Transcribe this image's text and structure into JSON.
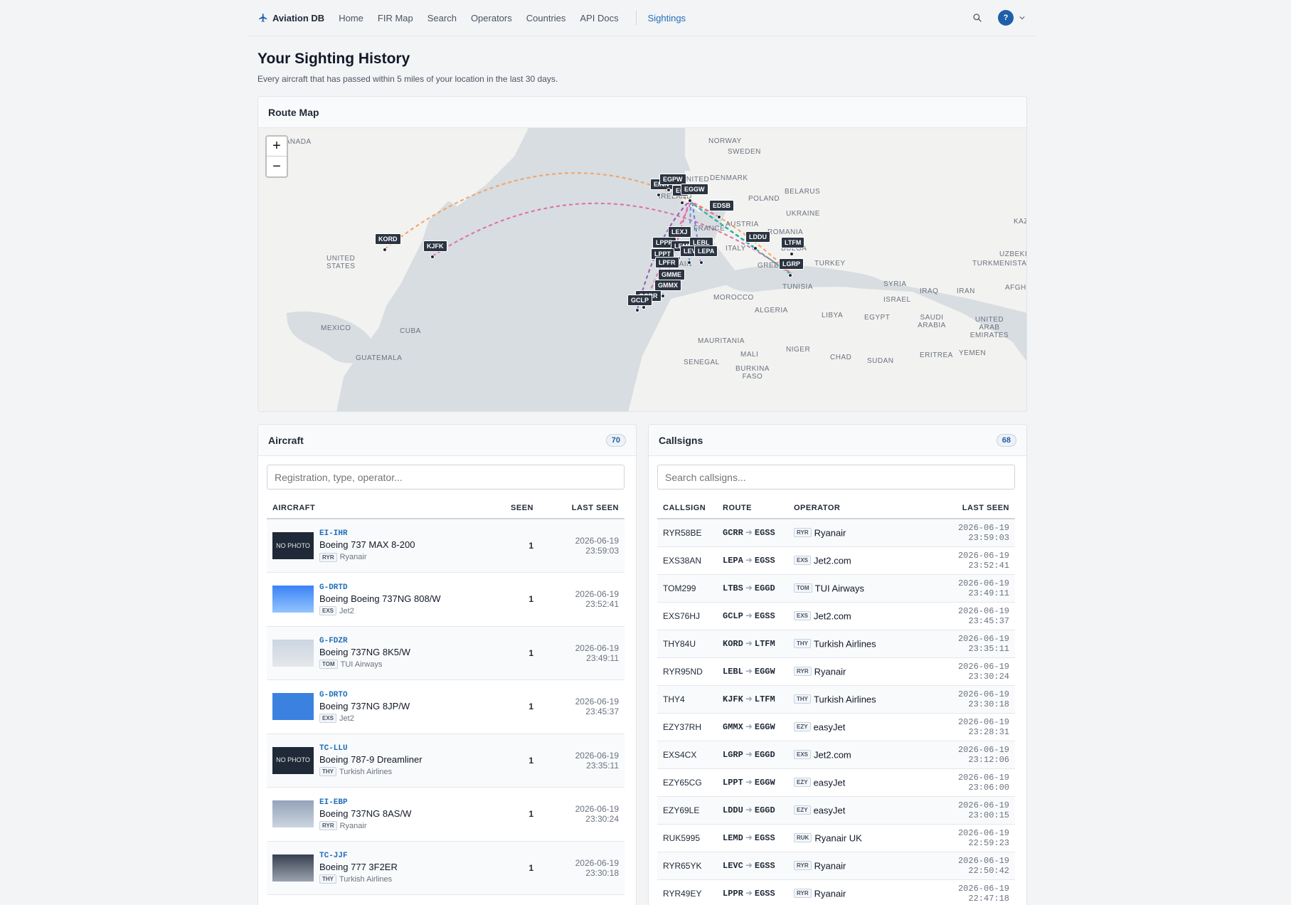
{
  "nav": {
    "brand": "Aviation DB",
    "links": [
      "Home",
      "FIR Map",
      "Search",
      "Operators",
      "Countries",
      "API Docs"
    ],
    "active": "Sightings",
    "help": "?"
  },
  "page": {
    "title": "Your Sighting History",
    "subtitle": "Every aircraft that has passed within 5 miles of your location in the last 30 days."
  },
  "map": {
    "title": "Route Map",
    "zoom_in": "+",
    "zoom_out": "−",
    "countries": [
      "CANADA",
      "UNITED STATES",
      "MEXICO",
      "CUBA",
      "GUATEMALA",
      "NORWAY",
      "SWEDEN",
      "DENMARK",
      "POLAND",
      "BELARUS",
      "UKRAINE",
      "KAZA",
      "AUSTRIA",
      "ROMANIA",
      "ITALY",
      "BULGA",
      "GREECE",
      "TURKEY",
      "UZBEKI",
      "TURKMENISTA",
      "SYRIA",
      "IRAQ",
      "IRAN",
      "AFGH",
      "TUNISIA",
      "ISRAEL",
      "ALGERIA",
      "LIBYA",
      "EGYPT",
      "SAUDI ARABIA",
      "UNITED ARAB EMIRATES",
      "MOROCCO",
      "MAURITANIA",
      "MALI",
      "NIGER",
      "CHAD",
      "SUDAN",
      "ERITREA",
      "YEMEN",
      "SENEGAL",
      "BURKINA FASO",
      "IRELAND",
      "UNITED",
      "FRANCE",
      "SPAIN"
    ],
    "airports": [
      "KORD",
      "KJFK",
      "EINN",
      "EGPW",
      "EG",
      "EGGW",
      "EDSB",
      "LEXJ",
      "LPPR",
      "LEMD",
      "LEBL",
      "LPPT",
      "LEVC",
      "LEPA",
      "LPFR",
      "LDDU",
      "LTFM",
      "LGRP",
      "GMME",
      "GMMX",
      "GCRR",
      "GCLP"
    ]
  },
  "aircraft_panel": {
    "title": "Aircraft",
    "count": "70",
    "search_placeholder": "Registration, type, operator...",
    "columns": [
      "AIRCRAFT",
      "SEEN",
      "LAST SEEN"
    ],
    "rows": [
      {
        "reg": "EI-IHR",
        "type": "Boeing 737 MAX 8-200",
        "code": "RYR",
        "operator": "Ryanair",
        "seen": "1",
        "last": "2026-06-19 23:59:03",
        "photo": "NO PHOTO"
      },
      {
        "reg": "G-DRTD",
        "type": "Boeing Boeing 737NG 808/W",
        "code": "EXS",
        "operator": "Jet2",
        "seen": "1",
        "last": "2026-06-19 23:52:41",
        "photo": ""
      },
      {
        "reg": "G-FDZR",
        "type": "Boeing 737NG 8K5/W",
        "code": "TOM",
        "operator": "TUI Airways",
        "seen": "1",
        "last": "2026-06-19 23:49:11",
        "photo": ""
      },
      {
        "reg": "G-DRTO",
        "type": "Boeing 737NG 8JP/W",
        "code": "EXS",
        "operator": "Jet2",
        "seen": "1",
        "last": "2026-06-19 23:45:37",
        "photo": ""
      },
      {
        "reg": "TC-LLU",
        "type": "Boeing 787-9 Dreamliner",
        "code": "THY",
        "operator": "Turkish Airlines",
        "seen": "1",
        "last": "2026-06-19 23:35:11",
        "photo": "NO PHOTO"
      },
      {
        "reg": "EI-EBP",
        "type": "Boeing 737NG 8AS/W",
        "code": "RYR",
        "operator": "Ryanair",
        "seen": "1",
        "last": "2026-06-19 23:30:24",
        "photo": ""
      },
      {
        "reg": "TC-JJF",
        "type": "Boeing 777 3F2ER",
        "code": "THY",
        "operator": "Turkish Airlines",
        "seen": "1",
        "last": "2026-06-19 23:30:18",
        "photo": ""
      }
    ]
  },
  "callsigns_panel": {
    "title": "Callsigns",
    "count": "68",
    "search_placeholder": "Search callsigns...",
    "columns": [
      "CALLSIGN",
      "ROUTE",
      "OPERATOR",
      "LAST SEEN"
    ],
    "rows": [
      {
        "callsign": "RYR58BE",
        "from": "GCRR",
        "to": "EGSS",
        "code": "RYR",
        "operator": "Ryanair",
        "last": "2026-06-19 23:59:03"
      },
      {
        "callsign": "EXS38AN",
        "from": "LEPA",
        "to": "EGSS",
        "code": "EXS",
        "operator": "Jet2.com",
        "last": "2026-06-19 23:52:41"
      },
      {
        "callsign": "TOM299",
        "from": "LTBS",
        "to": "EGGD",
        "code": "TOM",
        "operator": "TUI Airways",
        "last": "2026-06-19 23:49:11"
      },
      {
        "callsign": "EXS76HJ",
        "from": "GCLP",
        "to": "EGSS",
        "code": "EXS",
        "operator": "Jet2.com",
        "last": "2026-06-19 23:45:37"
      },
      {
        "callsign": "THY84U",
        "from": "KORD",
        "to": "LTFM",
        "code": "THY",
        "operator": "Turkish Airlines",
        "last": "2026-06-19 23:35:11"
      },
      {
        "callsign": "RYR95ND",
        "from": "LEBL",
        "to": "EGGW",
        "code": "RYR",
        "operator": "Ryanair",
        "last": "2026-06-19 23:30:24"
      },
      {
        "callsign": "THY4",
        "from": "KJFK",
        "to": "LTFM",
        "code": "THY",
        "operator": "Turkish Airlines",
        "last": "2026-06-19 23:30:18"
      },
      {
        "callsign": "EZY37RH",
        "from": "GMMX",
        "to": "EGGW",
        "code": "EZY",
        "operator": "easyJet",
        "last": "2026-06-19 23:28:31"
      },
      {
        "callsign": "EXS4CX",
        "from": "LGRP",
        "to": "EGGD",
        "code": "EXS",
        "operator": "Jet2.com",
        "last": "2026-06-19 23:12:06"
      },
      {
        "callsign": "EZY65CG",
        "from": "LPPT",
        "to": "EGGW",
        "code": "EZY",
        "operator": "easyJet",
        "last": "2026-06-19 23:06:00"
      },
      {
        "callsign": "EZY69LE",
        "from": "LDDU",
        "to": "EGGD",
        "code": "EZY",
        "operator": "easyJet",
        "last": "2026-06-19 23:00:15"
      },
      {
        "callsign": "RUK5995",
        "from": "LEMD",
        "to": "EGSS",
        "code": "RUK",
        "operator": "Ryanair UK",
        "last": "2026-06-19 22:59:23"
      },
      {
        "callsign": "RYR65YK",
        "from": "LEVC",
        "to": "EGSS",
        "code": "RYR",
        "operator": "Ryanair",
        "last": "2026-06-19 22:50:42"
      },
      {
        "callsign": "RYR49EY",
        "from": "LPPR",
        "to": "EGSS",
        "code": "RYR",
        "operator": "Ryanair",
        "last": "2026-06-19 22:47:18"
      }
    ]
  }
}
